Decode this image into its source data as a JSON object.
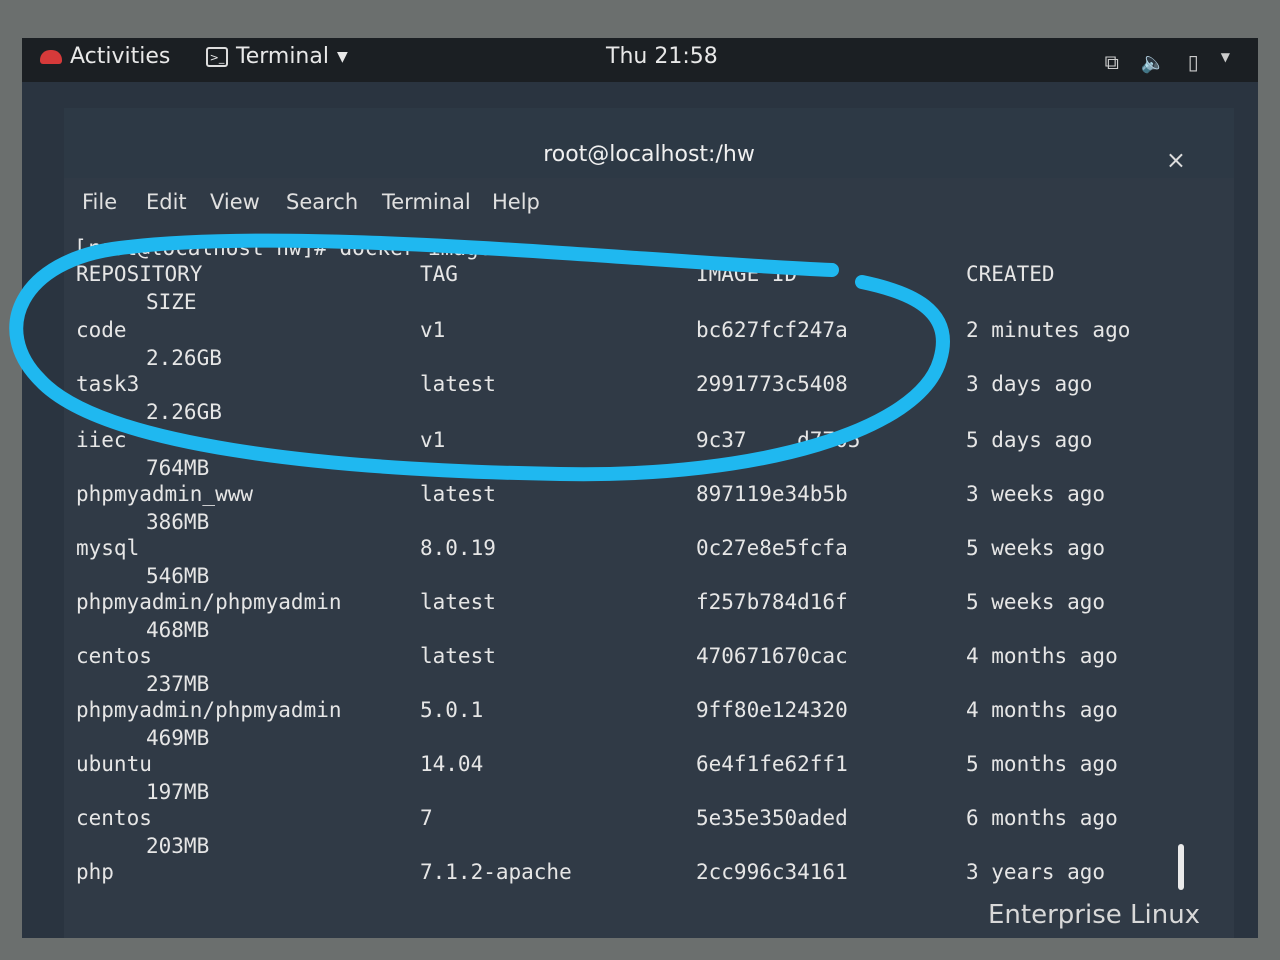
{
  "topbar": {
    "activities": "Activities",
    "app_menu": "Terminal",
    "clock": "Thu 21:58"
  },
  "window": {
    "title": "root@localhost:/hw",
    "close": "×",
    "menu": [
      "File",
      "Edit",
      "View",
      "Search",
      "Terminal",
      "Help"
    ]
  },
  "terminal": {
    "prompt": "[root@localhost hw]# docker images",
    "headers": {
      "repository": "REPOSITORY",
      "tag": "TAG",
      "image_id": "IMAGE ID",
      "created": "CREATED",
      "size": "SIZE"
    },
    "rows": [
      {
        "repository": "code",
        "tag": "v1",
        "image_id": "bc627fcf247a",
        "created": "2 minutes ago",
        "size": "2.26GB"
      },
      {
        "repository": "task3",
        "tag": "latest",
        "image_id": "2991773c5408",
        "created": "3 days ago",
        "size": "2.26GB"
      },
      {
        "repository": "iiec",
        "tag": "v1",
        "image_id": "9c37    d7705",
        "created": "5 days ago",
        "size": "764MB"
      },
      {
        "repository": "phpmyadmin_www",
        "tag": "latest",
        "image_id": "897119e34b5b",
        "created": "3 weeks ago",
        "size": "386MB"
      },
      {
        "repository": "mysql",
        "tag": "8.0.19",
        "image_id": "0c27e8e5fcfa",
        "created": "5 weeks ago",
        "size": "546MB"
      },
      {
        "repository": "phpmyadmin/phpmyadmin",
        "tag": "latest",
        "image_id": "f257b784d16f",
        "created": "5 weeks ago",
        "size": "468MB"
      },
      {
        "repository": "centos",
        "tag": "latest",
        "image_id": "470671670cac",
        "created": "4 months ago",
        "size": "237MB"
      },
      {
        "repository": "phpmyadmin/phpmyadmin",
        "tag": "5.0.1",
        "image_id": "9ff80e124320",
        "created": "4 months ago",
        "size": "469MB"
      },
      {
        "repository": "ubuntu",
        "tag": "14.04",
        "image_id": "6e4f1fe62ff1",
        "created": "5 months ago",
        "size": "197MB"
      },
      {
        "repository": "centos",
        "tag": "7",
        "image_id": "5e35e350aded",
        "created": "6 months ago",
        "size": "203MB"
      },
      {
        "repository": "php",
        "tag": "7.1.2-apache",
        "image_id": "2cc996c34161",
        "created": "3 years ago",
        "size": ""
      }
    ]
  },
  "watermark": "Enterprise Linux",
  "colors": {
    "highlight": "#1fb8f0",
    "terminal_bg": "#303a46",
    "topbar_bg": "#1b1f23"
  },
  "icons": [
    "redhat-icon",
    "terminal-icon",
    "network-icon",
    "volume-icon",
    "battery-icon",
    "chevron-down-icon"
  ]
}
